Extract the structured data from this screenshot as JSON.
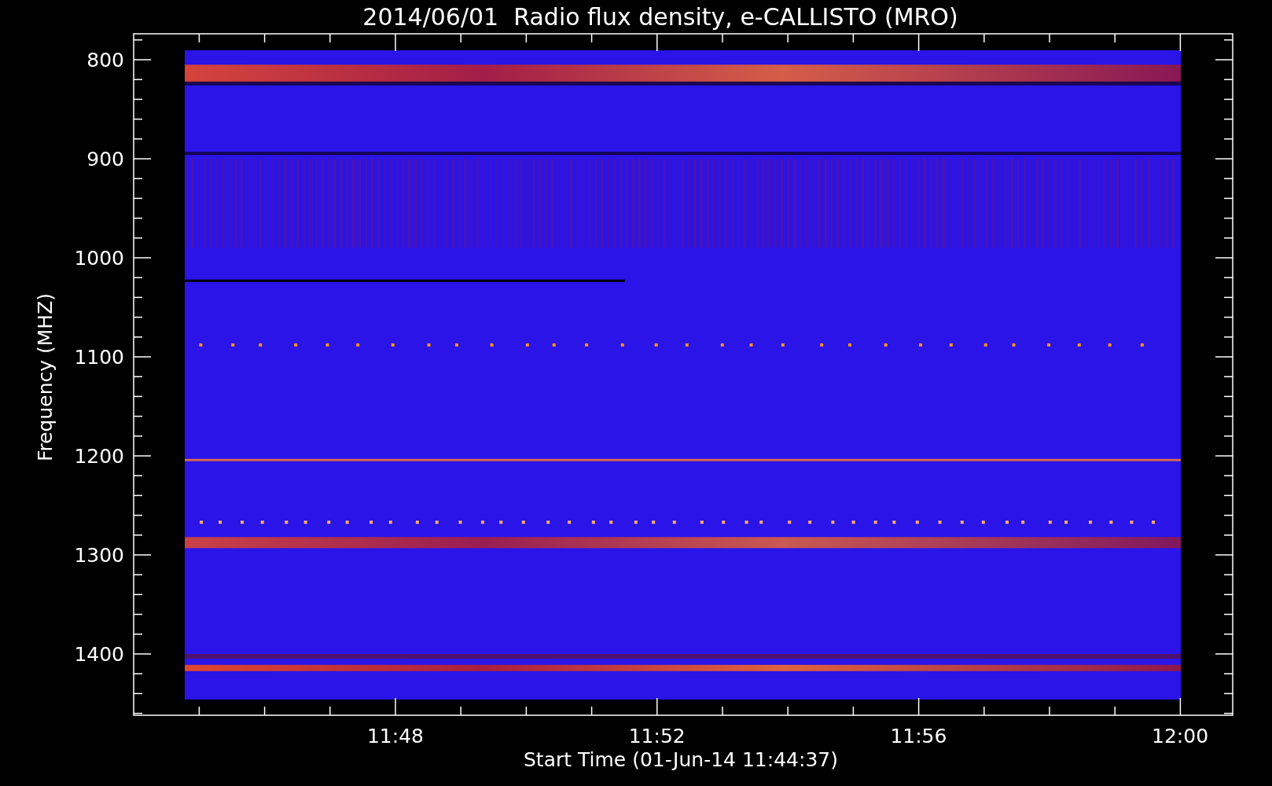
{
  "title": "2014/06/01  Radio flux density, e-CALLISTO (MRO)",
  "y_axis": {
    "label": "Frequency (MHZ)",
    "ticks": [
      "800",
      "900",
      "1000",
      "1100",
      "1200",
      "1300",
      "1400"
    ]
  },
  "x_axis": {
    "label": "Start Time (01-Jun-14 11:44:37)",
    "ticks": [
      "11:48",
      "11:52",
      "11:56",
      "12:00"
    ]
  }
}
